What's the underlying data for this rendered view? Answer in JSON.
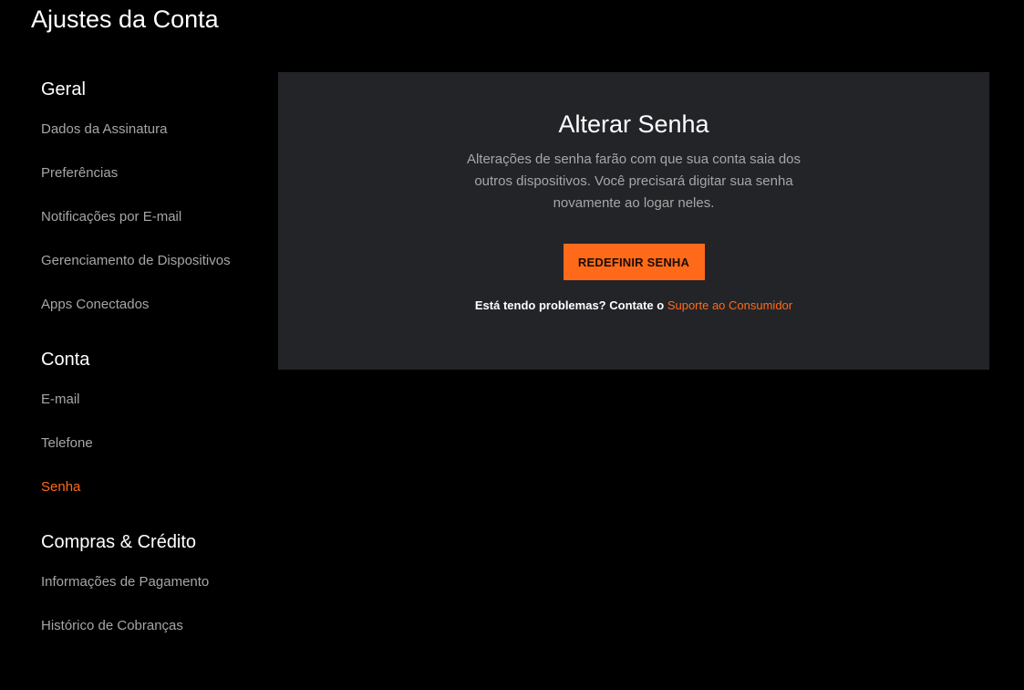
{
  "page": {
    "title": "Ajustes da Conta"
  },
  "sidebar": {
    "sections": [
      {
        "title": "Geral",
        "items": [
          "Dados da Assinatura",
          "Preferências",
          "Notificações por E-mail",
          "Gerenciamento de Dispositivos",
          "Apps Conectados"
        ]
      },
      {
        "title": "Conta",
        "items": [
          "E-mail",
          "Telefone",
          "Senha"
        ]
      },
      {
        "title": "Compras & Crédito",
        "items": [
          "Informações de Pagamento",
          "Histórico de Cobranças"
        ]
      }
    ],
    "active_item": "Senha"
  },
  "card": {
    "title": "Alterar Senha",
    "description": "Alterações de senha farão com que sua conta saia dos outros dispositivos. Você precisará digitar sua senha novamente ao logar neles.",
    "button_label": "REDEFINIR SENHA",
    "help_text": "Está tendo problemas? Contate o",
    "support_link": "Suporte ao Consumidor"
  },
  "colors": {
    "accent": "#ff6a1a",
    "background": "#000000",
    "card_background": "#232428",
    "muted_text": "#a6a6a6"
  }
}
